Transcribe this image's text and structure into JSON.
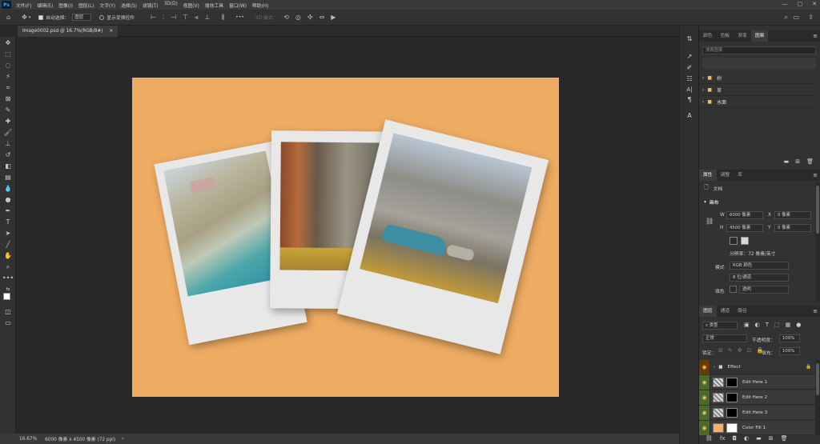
{
  "app": {
    "logo": "Ps"
  },
  "menubar": {
    "items": [
      "文件(F)",
      "编辑(E)",
      "图像(I)",
      "图层(L)",
      "文字(Y)",
      "选择(S)",
      "滤镜(T)",
      "3D(D)",
      "视图(V)",
      "增效工具",
      "窗口(W)",
      "帮助(H)"
    ],
    "win_controls": [
      "—",
      "▢",
      "✕"
    ]
  },
  "options": {
    "auto_select_label": "自动选择：",
    "auto_select_value": "图层",
    "show_transform_label": "显示变换控件",
    "more": "•••",
    "mode_label": "3D 模式："
  },
  "document": {
    "tab_title": "Image0002.psd @ 16.7%(RGB/8#)",
    "close": "×"
  },
  "status": {
    "zoom": "16.67%",
    "info": "6000 像素 x 4500 像素 (72 ppi)",
    "arrow": "›"
  },
  "panels": {
    "top_tabs": [
      "颜色",
      "色板",
      "渐变",
      "图案"
    ],
    "top_active": 3,
    "pattern_search_placeholder": "搜索图案",
    "pattern_folders": [
      "树",
      "草",
      "水面"
    ],
    "mid_tabs": [
      "属性",
      "调整",
      "库"
    ],
    "mid_active": 0,
    "props": {
      "doc_label": "文档",
      "section": "画布",
      "w_label": "W",
      "w_value": "6000 像素",
      "h_label": "H",
      "h_value": "4500 像素",
      "x_label": "X",
      "x_value": "0 像素",
      "y_label": "Y",
      "y_value": "0 像素",
      "resolution": "分辨率：72 像素/英寸",
      "mode_label": "模式",
      "mode_value": "RGB 颜色",
      "depth_value": "8 位/通道",
      "fill_label": "填色",
      "fill_value": "透明"
    },
    "bottom_tabs": [
      "图层",
      "通道",
      "路径"
    ],
    "bottom_active": 0,
    "layers": {
      "kind_label": "类型",
      "blend_mode": "正常",
      "opacity_label": "不透明度：",
      "opacity_value": "100%",
      "lock_label": "锁定：",
      "fill_label": "填充：",
      "fill_value": "100%",
      "items": [
        {
          "name": "Effect",
          "type": "group",
          "eye_color": "#6a3a00"
        },
        {
          "name": "Edit Here 1",
          "type": "smart",
          "eye_color": "#4a6a2a"
        },
        {
          "name": "Edit Here 2",
          "type": "smart",
          "eye_color": "#4a6a2a"
        },
        {
          "name": "Edit Here 3",
          "type": "smart",
          "eye_color": "#4a6a2a"
        },
        {
          "name": "Color Fill 1",
          "type": "fill",
          "eye_color": "#4a6a2a",
          "fill_color": "#f2b06b"
        }
      ]
    }
  },
  "canvas": {
    "background_color": "#eeac62"
  }
}
